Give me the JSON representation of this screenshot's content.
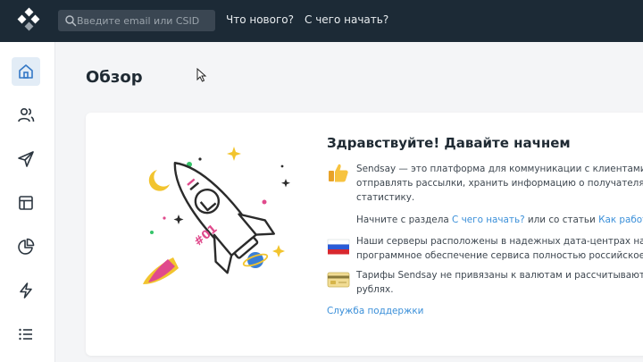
{
  "topbar": {
    "search_placeholder": "Введите email или CSID",
    "nav": [
      "Что нового?",
      "С чего начать?"
    ]
  },
  "sidebar": {
    "items": [
      {
        "icon": "home-icon",
        "active": true
      },
      {
        "icon": "users-icon",
        "active": false
      },
      {
        "icon": "send-icon",
        "active": false
      },
      {
        "icon": "layout-icon",
        "active": false
      },
      {
        "icon": "pie-chart-icon",
        "active": false
      },
      {
        "icon": "lightning-icon",
        "active": false
      },
      {
        "icon": "list-icon",
        "active": false
      }
    ]
  },
  "page": {
    "title": "Обзор"
  },
  "welcome": {
    "title": "Здравствуйте! Давайте начнем",
    "rocket_label": "#01",
    "intro_line1": "Sendsay — это платформа для коммуникации с клиентами: зд",
    "intro_line2": "отправлять рассылки, хранить информацию о получателях и",
    "intro_line3": "статистику.",
    "start_prefix": "Начните с раздела ",
    "start_link": "С чего начать?",
    "start_middle": " или со статьи ",
    "start_link2": "Как работает",
    "servers_line1": "Наши серверы расположены в надежных дата-центрах на те",
    "servers_line2": "программное обеспечение сервиса полностью российское.",
    "tariffs_line1": "Тарифы Sendsay не привязаны к валютам и рассчитываются",
    "tariffs_line2": "рублях.",
    "support_link": "Служба поддержки"
  },
  "colors": {
    "topbar": "#1c2a36",
    "link": "#3a8fd9",
    "sidebar_active": "#e2ecf6"
  }
}
